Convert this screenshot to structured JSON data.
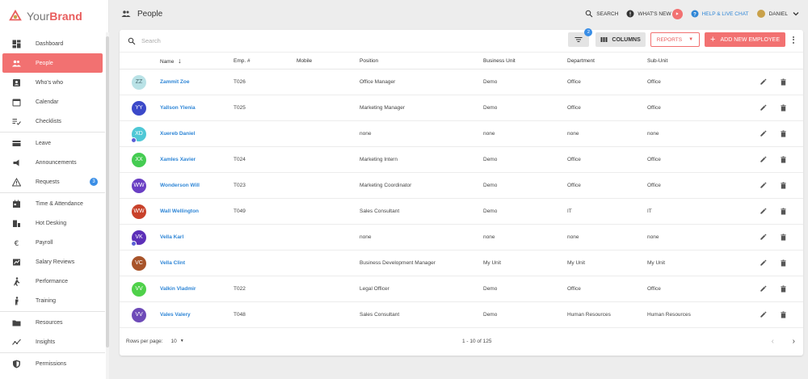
{
  "brand": {
    "prefix": "Your",
    "suffix": "Brand"
  },
  "sidebar": {
    "items": [
      {
        "label": "Dashboard",
        "icon": "dashboard-icon"
      },
      {
        "label": "People",
        "icon": "people-icon",
        "active": true
      },
      {
        "label": "Who's who",
        "icon": "contacts-icon"
      },
      {
        "label": "Calendar",
        "icon": "calendar-icon"
      },
      {
        "label": "Checklists",
        "icon": "checklist-icon"
      },
      {
        "label": "Leave",
        "icon": "leave-icon"
      },
      {
        "label": "Announcements",
        "icon": "megaphone-icon"
      },
      {
        "label": "Requests",
        "icon": "warning-icon",
        "badge": "3"
      },
      {
        "label": "Time & Attendance",
        "icon": "time-icon"
      },
      {
        "label": "Hot Desking",
        "icon": "desk-icon"
      },
      {
        "label": "Payroll",
        "icon": "euro-icon"
      },
      {
        "label": "Salary Reviews",
        "icon": "salary-icon"
      },
      {
        "label": "Performance",
        "icon": "performance-icon"
      },
      {
        "label": "Training",
        "icon": "training-icon"
      },
      {
        "label": "Resources",
        "icon": "folder-icon"
      },
      {
        "label": "Insights",
        "icon": "insights-icon"
      },
      {
        "label": "Permissions",
        "icon": "shield-icon"
      }
    ]
  },
  "header": {
    "title": "People",
    "search_label": "SEARCH",
    "whats_new_label": "WHAT'S NEW",
    "help_label": "HELP & LIVE CHAT",
    "user_label": "DANIEL"
  },
  "toolbar": {
    "search_placeholder": "Search",
    "filter_badge": "2",
    "columns_label": "COLUMNS",
    "reports_label": "REPORTS",
    "add_label": "ADD NEW EMPLOYEE"
  },
  "table": {
    "headers": [
      "Name",
      "Emp. #",
      "Mobile",
      "Position",
      "Business Unit",
      "Department",
      "Sub-Unit"
    ],
    "rows": [
      {
        "initials": "ZZ",
        "color": "#b9e2e6",
        "text": "#4a6b70",
        "name": "Zammit Zoe",
        "emp": "T026",
        "mobile": "",
        "position": "Office Manager",
        "bu": "Demo",
        "dept": "Office",
        "sub": "Office",
        "tag": false
      },
      {
        "initials": "YY",
        "color": "#3b49c9",
        "text": "#ffffff",
        "name": "Yallson Ylenia",
        "emp": "T025",
        "mobile": "",
        "position": "Marketing Manager",
        "bu": "Demo",
        "dept": "Office",
        "sub": "Office",
        "tag": false
      },
      {
        "initials": "XD",
        "color": "#4fc8d6",
        "text": "#ffffff",
        "name": "Xuereb Daniel",
        "emp": "",
        "mobile": "",
        "position": "none",
        "bu": "none",
        "dept": "none",
        "sub": "none",
        "tag": true
      },
      {
        "initials": "XX",
        "color": "#45cc52",
        "text": "#ffffff",
        "name": "Xamles Xavier",
        "emp": "T024",
        "mobile": "",
        "position": "Marketing Intern",
        "bu": "Demo",
        "dept": "Office",
        "sub": "Office",
        "tag": false
      },
      {
        "initials": "WW",
        "color": "#6a3fc4",
        "text": "#ffffff",
        "name": "Wonderson Will",
        "emp": "T023",
        "mobile": "",
        "position": "Marketing Coordinator",
        "bu": "Demo",
        "dept": "Office",
        "sub": "Office",
        "tag": false
      },
      {
        "initials": "WW",
        "color": "#c8412a",
        "text": "#ffffff",
        "name": "Wall Wellington",
        "emp": "T049",
        "mobile": "",
        "position": "Sales Consultant",
        "bu": "Demo",
        "dept": "IT",
        "sub": "IT",
        "tag": false
      },
      {
        "initials": "VK",
        "color": "#5c2fb8",
        "text": "#ffffff",
        "name": "Vella Karl",
        "emp": "",
        "mobile": "",
        "position": "none",
        "bu": "none",
        "dept": "none",
        "sub": "none",
        "tag": true
      },
      {
        "initials": "VC",
        "color": "#a8542a",
        "text": "#ffffff",
        "name": "Vella Clint",
        "emp": "",
        "mobile": "",
        "position": "Business Development Manager",
        "bu": "My Unit",
        "dept": "My Unit",
        "sub": "My Unit",
        "tag": false
      },
      {
        "initials": "VV",
        "color": "#4fd14a",
        "text": "#ffffff",
        "name": "Valkin Vladmir",
        "emp": "T022",
        "mobile": "",
        "position": "Legal Officer",
        "bu": "Demo",
        "dept": "Office",
        "sub": "Office",
        "tag": false
      },
      {
        "initials": "VV",
        "color": "#6e4bb8",
        "text": "#ffffff",
        "name": "Vales Valery",
        "emp": "T048",
        "mobile": "",
        "position": "Sales Consultant",
        "bu": "Demo",
        "dept": "Human Resources",
        "sub": "Human Resources",
        "tag": false
      }
    ]
  },
  "footer": {
    "rows_per_page_label": "Rows per page:",
    "rows_per_page_value": "10",
    "range": "1 - 10 of 125"
  },
  "colors": {
    "accent": "#f27171",
    "link": "#2f86d6",
    "badge": "#3a8ee6"
  }
}
